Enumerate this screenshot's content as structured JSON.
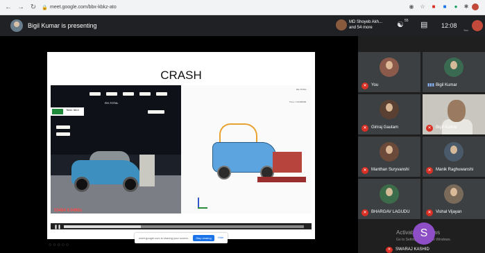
{
  "browser": {
    "url": "meet.google.com/bbx-kbkz-ato",
    "back_icon": "arrow-left-icon",
    "forward_icon": "arrow-right-icon",
    "reload_icon": "reload-icon"
  },
  "topbar": {
    "presenting": "Bigil Kumar is presenting",
    "participants_line1": "MD Shoyeb Akh...",
    "participants_line2": "and 54 more",
    "people_count": "55",
    "time": "12:08",
    "self_label": "You"
  },
  "slide": {
    "title": "CRASH",
    "photo_label": "RH-TOTAL",
    "photo_time": "Time: 58.0",
    "photo_readout": "03464 0.0490s",
    "sim_header": "RH-TOTAL",
    "sim_time": "Time = 0.0490000",
    "video_progress": 0.32
  },
  "share_bar": {
    "text": "meet.google.com is sharing your screen.",
    "stop_label": "Stop sharing",
    "hide_label": "Hide"
  },
  "participants": [
    {
      "name": "You",
      "muted": true,
      "avatar_color": "#8c5a4a"
    },
    {
      "name": "Bigil Kumar",
      "muted": false,
      "avatar_color": "#3a6b52"
    },
    {
      "name": "Giriraj Gautam",
      "muted": true,
      "avatar_color": "#5a4033"
    },
    {
      "name": "Bigil Kumar",
      "muted": true,
      "video": true
    },
    {
      "name": "Manthan Suryvanshi",
      "muted": true,
      "avatar_color": "#6b4a3a"
    },
    {
      "name": "Manik Raghuwanshi",
      "muted": true,
      "avatar_color": "#4a5a6b"
    },
    {
      "name": "BHARGAV LAGUDU",
      "muted": true,
      "avatar_color": "#3c6b4a"
    },
    {
      "name": "Vishal Vijayan",
      "muted": true,
      "avatar_color": "#7a6a5a"
    }
  ],
  "bottom_tile": {
    "initial": "S",
    "name": "SWARAJ KASHID",
    "watermark_title": "Activate Windows",
    "watermark_sub": "Go to Settings to activate Windows."
  }
}
